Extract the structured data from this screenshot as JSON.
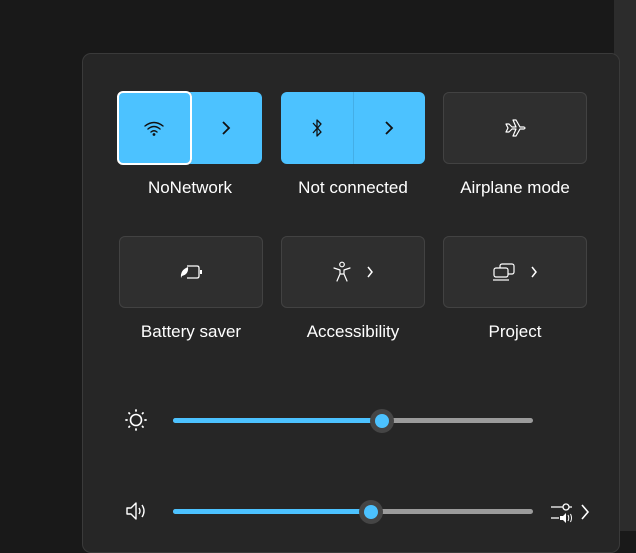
{
  "quick_settings": {
    "tiles": [
      {
        "id": "wifi",
        "label": "NoNetwork",
        "state": "on",
        "icon": "wifi-icon",
        "has_expand": true
      },
      {
        "id": "bluetooth",
        "label": "Not connected",
        "state": "on",
        "icon": "bluetooth-icon",
        "has_expand": true
      },
      {
        "id": "airplane",
        "label": "Airplane mode",
        "state": "off",
        "icon": "airplane-icon",
        "has_expand": false
      },
      {
        "id": "battery_saver",
        "label": "Battery saver",
        "state": "off",
        "icon": "battery-saver-icon",
        "has_expand": false
      },
      {
        "id": "accessibility",
        "label": "Accessibility",
        "state": "off",
        "icon": "accessibility-icon",
        "has_expand": true
      },
      {
        "id": "project",
        "label": "Project",
        "state": "off",
        "icon": "project-icon",
        "has_expand": true
      }
    ],
    "sliders": {
      "brightness": {
        "icon": "brightness-icon",
        "value_percent": 58
      },
      "volume": {
        "icon": "speaker-icon",
        "value_percent": 55,
        "mixer_icon": "volume-mixer-icon"
      }
    },
    "accent_color": "#4cc2ff"
  }
}
